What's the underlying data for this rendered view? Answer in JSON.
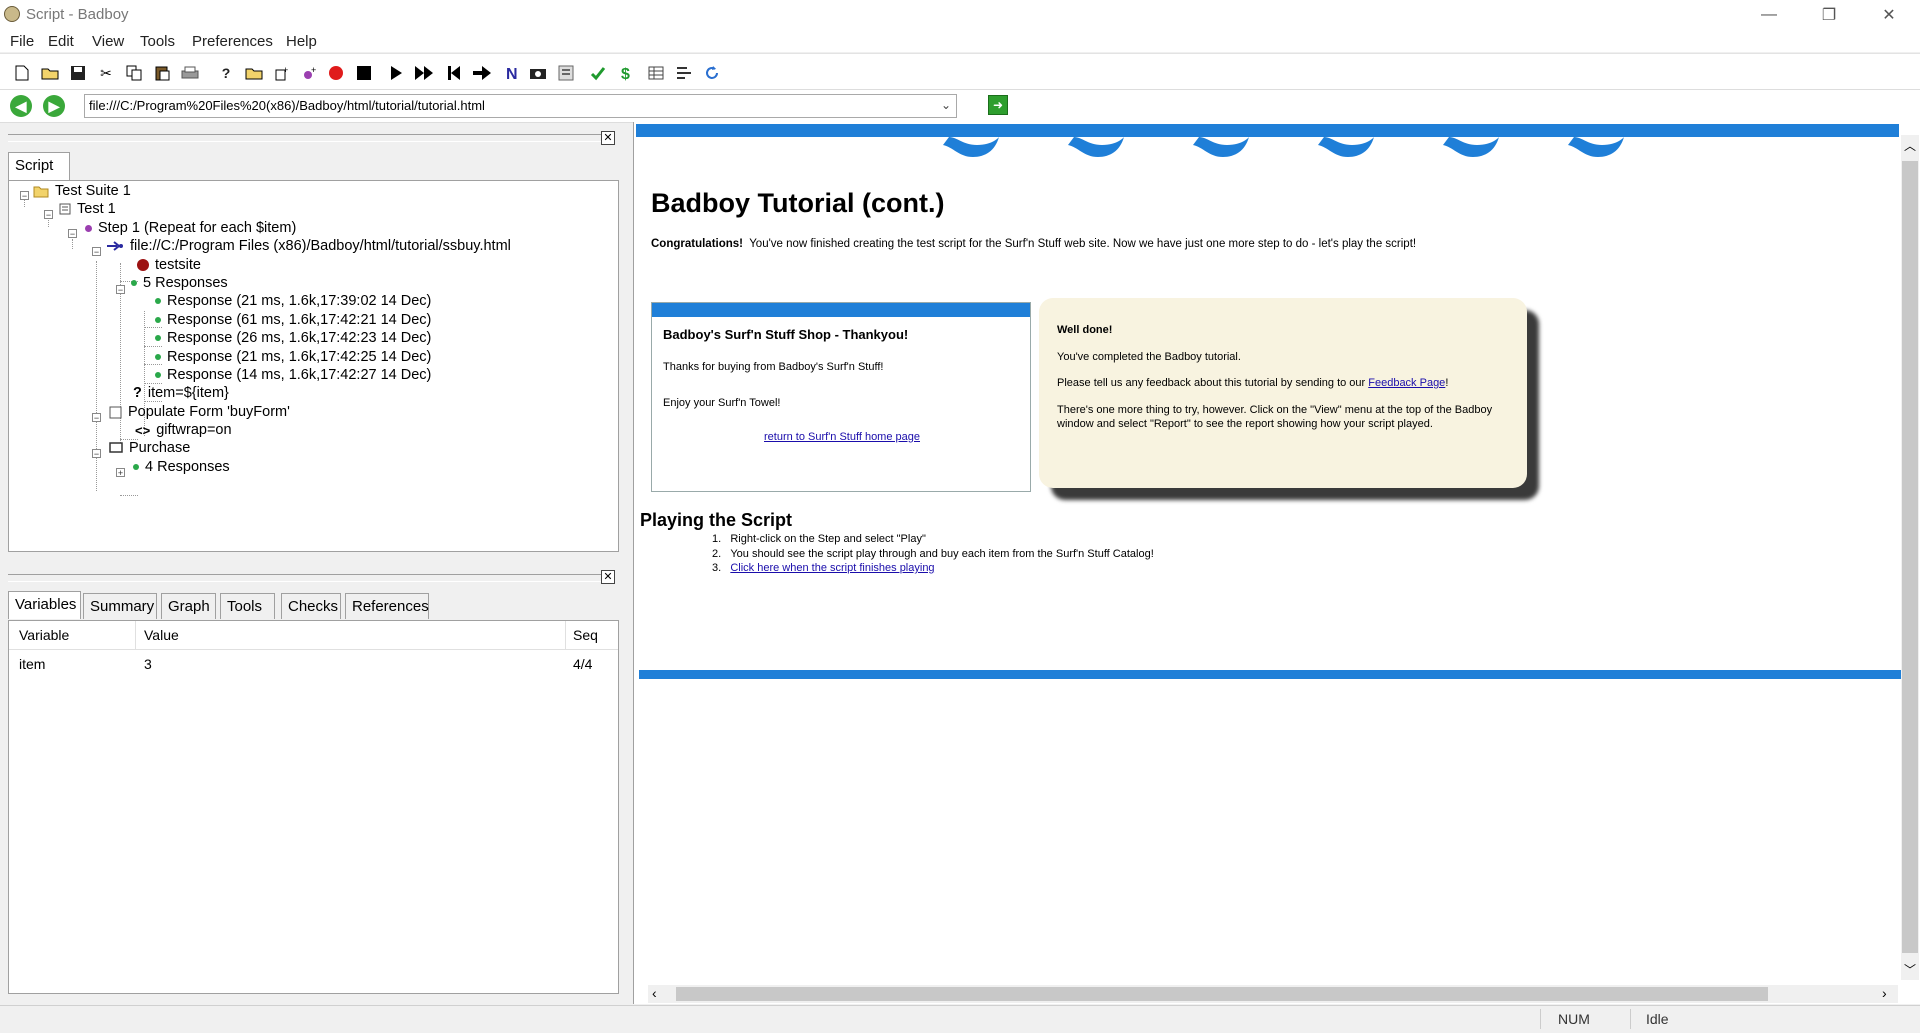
{
  "window": {
    "title": "Script - Badboy",
    "minimize_glyph": "—",
    "restore_glyph": "❐",
    "close_glyph": "✕"
  },
  "menu": [
    "File",
    "Edit",
    "View",
    "Tools",
    "Preferences",
    "Help"
  ],
  "toolbar": {
    "icons": [
      "new-icon",
      "open-icon",
      "save-icon",
      "cut-icon",
      "copy-icon",
      "paste-icon",
      "print-icon",
      "help-icon",
      "folder-add-icon",
      "add-item-icon",
      "add-step-icon",
      "record-icon",
      "stop-icon",
      "play-icon",
      "play-all-icon",
      "rewind-icon",
      "step-forward-icon",
      "n-icon",
      "camera-icon",
      "list-icon",
      "check-icon",
      "dollar-icon",
      "table-icon",
      "align-icon",
      "refresh-icon"
    ],
    "colors": {
      "record": "#e01b1b",
      "check": "#1f9a2e",
      "dollar": "#1f9a2e",
      "n": "#2a2aa0",
      "refresh": "#2a6fd0"
    }
  },
  "address": {
    "url": "file:///C:/Program%20Files%20(x86)/Badboy/html/tutorial/tutorial.html"
  },
  "script_pane": {
    "tab": "Script",
    "tree": {
      "suite": "Test Suite 1",
      "test": "Test 1",
      "step": "Step 1 (Repeat for each $item)",
      "request": "file://C:/Program Files (x86)/Badboy/html/tutorial/ssbuy.html",
      "testsite": "testsite",
      "responses_group": "5 Responses",
      "responses": [
        "Response (21 ms, 1.6k,17:39:02 14 Dec)",
        "Response (61 ms, 1.6k,17:42:21 14 Dec)",
        "Response (26 ms, 1.6k,17:42:23 14 Dec)",
        "Response (21 ms, 1.6k,17:42:25 14 Dec)",
        "Response (14 ms, 1.6k,17:42:27 14 Dec)"
      ],
      "assign": "item=${item}",
      "form": "Populate Form 'buyForm'",
      "form_field": "giftwrap=on",
      "purchase": "Purchase",
      "purchase_responses": "4 Responses"
    }
  },
  "vars_pane": {
    "tabs": [
      "Variables",
      "Summary",
      "Graph",
      "Tools",
      "Checks",
      "References"
    ],
    "columns": [
      "Variable",
      "Value",
      "Seq"
    ],
    "rows": [
      [
        "item",
        "3",
        "4/4"
      ]
    ]
  },
  "page": {
    "heading": "Badboy Tutorial (cont.)",
    "intro_bold": "Congratulations!",
    "intro_text": "You've now finished creating the test script for the Surf'n Stuff web site. Now we have just one more step to do - let's play the script!",
    "shop_box": {
      "title": "Badboy's Surf'n Stuff Shop - Thankyou!",
      "line1": "Thanks for buying from Badboy's Surf'n Stuff!",
      "line2": "Enjoy your Surf'n Towel!",
      "link": "return to Surf'n Stuff home page"
    },
    "note_box": {
      "title": "Well done!",
      "p1": "You've completed the Badboy tutorial.",
      "p2_pre": "Please tell us any feedback about this tutorial by sending to our ",
      "p2_link": "Feedback Page",
      "p2_post": "!",
      "p3": "There's one more thing to try, however. Click on the \"View\" menu at the top of the Badboy window and select \"Report\" to see the report showing how your script played."
    },
    "section_title": "Playing the Script",
    "steps": [
      "Right-click on the Step and select \"Play\"",
      "You should see the script play through and buy each item from the Surf'n Stuff Catalog!"
    ],
    "step3_link": "Click here when the script finishes playing",
    "colors": {
      "band": "#1f7fd8",
      "note_bg": "#f8f3e0"
    }
  },
  "status": {
    "num": "NUM",
    "state": "Idle"
  }
}
